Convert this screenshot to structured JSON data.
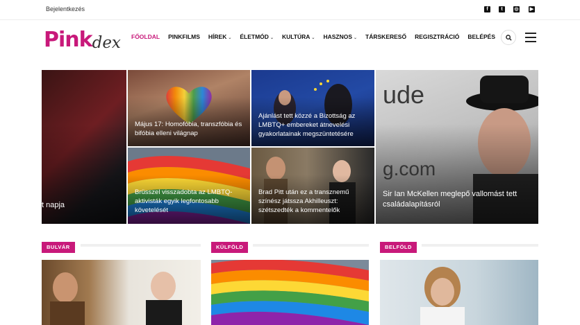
{
  "topbar": {
    "login_label": "Bejelentkezés",
    "social": [
      {
        "icon": "facebook-icon",
        "glyph": "f"
      },
      {
        "icon": "twitter-icon",
        "glyph": "t"
      },
      {
        "icon": "instagram-icon",
        "glyph": "◎"
      },
      {
        "icon": "youtube-icon",
        "glyph": "▶"
      }
    ]
  },
  "logo": {
    "part1": "Pink",
    "part2": "dex"
  },
  "nav": {
    "items": [
      {
        "label": "FŐOLDAL",
        "has_caret": false,
        "active": true
      },
      {
        "label": "PINKFILMS",
        "has_caret": false,
        "active": false
      },
      {
        "label": "HÍREK",
        "has_caret": true,
        "active": false
      },
      {
        "label": "ÉLETMÓD",
        "has_caret": true,
        "active": false
      },
      {
        "label": "KULTÚRA",
        "has_caret": true,
        "active": false
      },
      {
        "label": "HASZNOS",
        "has_caret": true,
        "active": false
      },
      {
        "label": "TÁRSKERESŐ",
        "has_caret": false,
        "active": false
      },
      {
        "label": "REGISZTRÁCIÓ",
        "has_caret": false,
        "active": false
      },
      {
        "label": "BELÉPÉS",
        "has_caret": false,
        "active": false
      }
    ]
  },
  "hero": {
    "left_partial": "t napja",
    "tile_1": "Május 17: Homofóbia, transzfóbia és bifóbia elleni világnap",
    "tile_2": "Ajánlást tett közzé a Bizottság az LMBTQ+ embereket átnevelési gyakorlatainak megszüntetésére",
    "tile_3": "Brüsszel visszadobta az LMBTQ-aktivisták egyik legfontosabb követelését",
    "tile_4": "Brad Pitt után ez a transznemű színész játssza Akhilleuszt: szétszedték a kommentelők",
    "tile_5": "Sir Ian McKellen meglepő vallomást tett családalapításról"
  },
  "sections": [
    {
      "label": "BULVÁR"
    },
    {
      "label": "KÜLFÖLD"
    },
    {
      "label": "BELFÖLD"
    }
  ],
  "colors": {
    "accent": "#c8197a"
  }
}
